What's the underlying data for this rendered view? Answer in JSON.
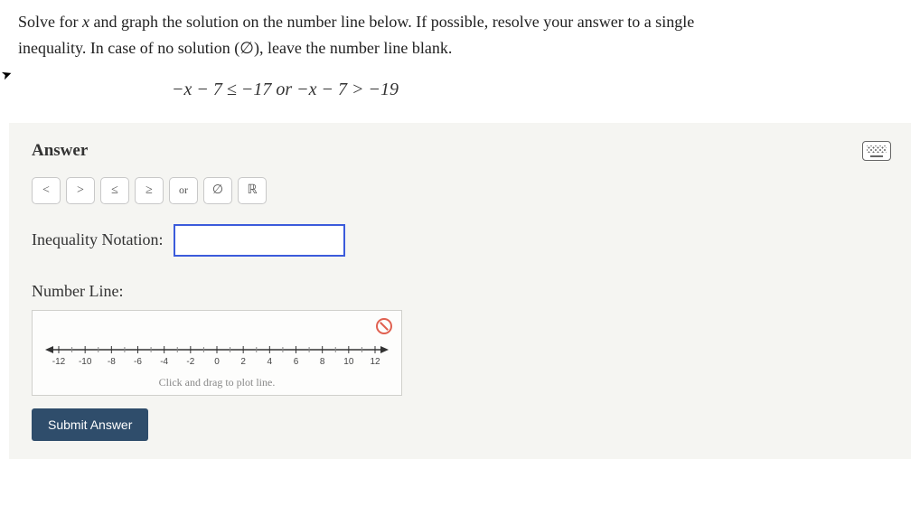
{
  "problem": {
    "line1_pre": "Solve for ",
    "line1_var": "x",
    "line1_post": " and graph the solution on the number line below. If possible, resolve your answer to a single",
    "line2": "inequality. In case of no solution (∅), leave the number line blank."
  },
  "equation": "−x − 7 ≤ −17   or   −x − 7 > −19",
  "answer": {
    "heading": "Answer",
    "symbols": [
      "<",
      ">",
      "≤",
      "≥",
      "or",
      "∅",
      "ℝ"
    ],
    "notation_label": "Inequality Notation:",
    "notation_value": "",
    "numberline_label": "Number Line:",
    "ticks": [
      "-12",
      "-10",
      "-8",
      "-6",
      "-4",
      "-2",
      "0",
      "2",
      "4",
      "6",
      "8",
      "10",
      "12"
    ],
    "hint": "Click and drag to plot line.",
    "submit": "Submit Answer"
  }
}
